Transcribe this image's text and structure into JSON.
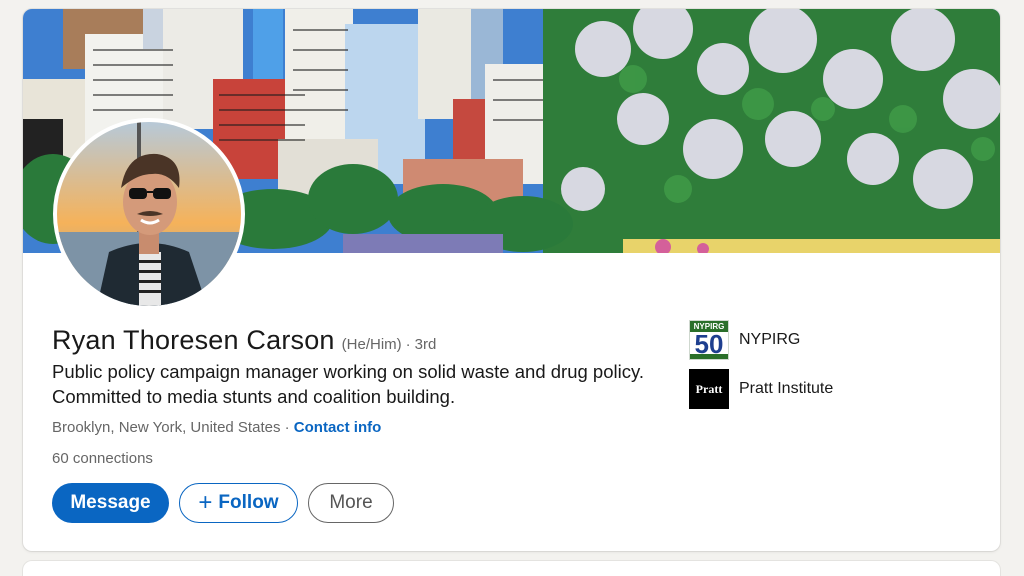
{
  "profile": {
    "name": "Ryan Thoresen Carson",
    "pronouns": "(He/Him)",
    "separator": "·",
    "degree": "3rd",
    "headline": "Public policy campaign manager working on solid waste and drug policy. Committed to media stunts and coalition building.",
    "location": "Brooklyn, New York, United States",
    "location_separator": " · ",
    "contact_info": "Contact info",
    "connections": "60 connections"
  },
  "actions": {
    "message": "Message",
    "follow_plus": "+",
    "follow": "Follow",
    "more": "More"
  },
  "organizations": [
    {
      "name": "NYPIRG",
      "logo_top": "NYPIRG",
      "logo_number": "50"
    },
    {
      "name": "Pratt Institute",
      "logo_text": "Pratt"
    }
  ],
  "colors": {
    "accent": "#0a66c2",
    "page_background": "#f3f2ef",
    "card": "#ffffff",
    "text_primary": "#191919",
    "text_secondary": "#666666"
  },
  "icons": {
    "avatar": "profile-photo",
    "banner": "city-park-illustration"
  }
}
